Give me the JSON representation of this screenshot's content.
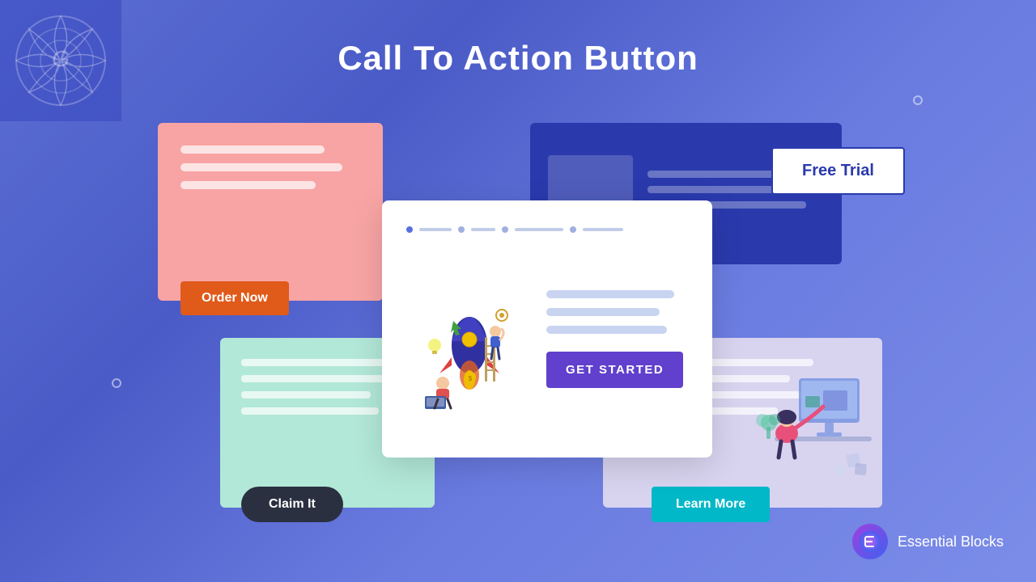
{
  "page": {
    "title": "Call To Action Button",
    "background_gradient_start": "#5b6fd4",
    "background_gradient_end": "#7b8ce8"
  },
  "cards": {
    "pink": {
      "lines": 3,
      "button_label": "Order Now"
    },
    "blue": {
      "button_label": "Free Trial"
    },
    "mint": {
      "lines": 4,
      "button_label": "Claim It"
    },
    "lavender": {
      "lines": 4,
      "button_label": "Learn More"
    },
    "center": {
      "button_label": "GET STARTED",
      "lines": 3
    }
  },
  "branding": {
    "label": "Essential Blocks",
    "icon_letter": "ε"
  }
}
